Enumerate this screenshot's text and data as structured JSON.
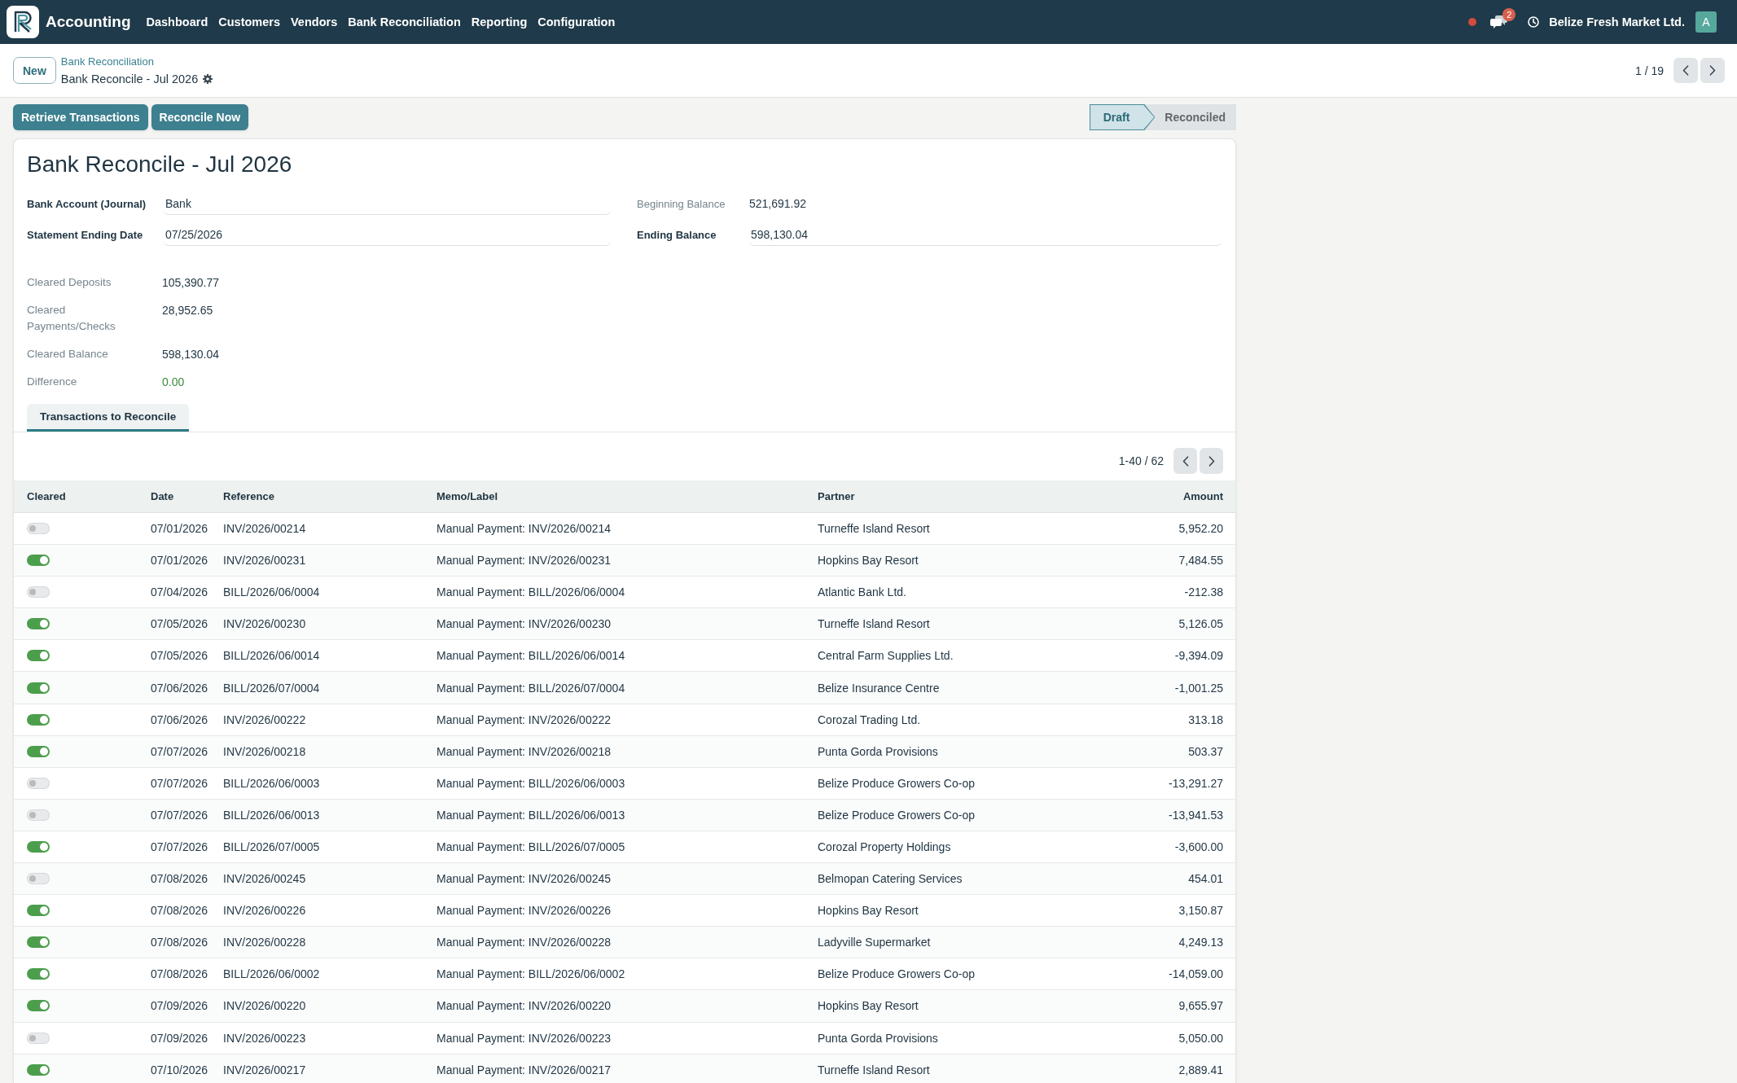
{
  "navbar": {
    "app_name": "Accounting",
    "menu": [
      "Dashboard",
      "Customers",
      "Vendors",
      "Bank Reconciliation",
      "Reporting",
      "Configuration"
    ],
    "messages_badge": "2",
    "company": "Belize Fresh Market Ltd.",
    "avatar": "A"
  },
  "control_panel": {
    "new_button": "New",
    "breadcrumb": "Bank Reconciliation",
    "record_title": "Bank Reconcile - Jul 2026",
    "pager": "1 / 19"
  },
  "action_buttons": [
    "Retrieve Transactions",
    "Reconcile Now"
  ],
  "status_steps": [
    {
      "label": "Draft",
      "selected": true
    },
    {
      "label": "Reconciled",
      "selected": false
    }
  ],
  "form": {
    "title": "Bank Reconcile - Jul 2026",
    "fields_left": [
      {
        "label": "Bank Account (Journal)",
        "value": "Bank",
        "readonly": false
      },
      {
        "label": "Statement Ending Date",
        "value": "07/25/2026",
        "readonly": false
      }
    ],
    "fields_right": [
      {
        "label": "Beginning Balance",
        "value": "521,691.92",
        "readonly": true
      },
      {
        "label": "Ending Balance",
        "value": "598,130.04",
        "readonly": false
      }
    ],
    "summary": [
      {
        "label": "Cleared Deposits",
        "value": "105,390.77",
        "readonly": true
      },
      {
        "label": "Cleared Payments/Checks",
        "value": "28,952.65",
        "readonly": true
      },
      {
        "label": "Cleared Balance",
        "value": "598,130.04",
        "readonly": true
      }
    ],
    "difference": {
      "label": "Difference",
      "value": "0.00",
      "balanced": true
    }
  },
  "tabs": [
    {
      "label": "Transactions to Reconcile",
      "selected": true
    }
  ],
  "table": {
    "pager": "1-40 / 62",
    "columns": [
      {
        "label": "Cleared",
        "kind": "toggle"
      },
      {
        "label": "Date",
        "kind": "text"
      },
      {
        "label": "Reference",
        "kind": "text"
      },
      {
        "label": "Memo/Label",
        "kind": "text"
      },
      {
        "label": "Partner",
        "kind": "text"
      },
      {
        "label": "Amount",
        "kind": "number"
      }
    ],
    "rows": [
      {
        "cells": [
          false,
          "07/01/2026",
          "INV/2026/00214",
          "Manual Payment: INV/2026/00214",
          "Turneffe Island Resort",
          "5,952.20"
        ]
      },
      {
        "cells": [
          true,
          "07/01/2026",
          "INV/2026/00231",
          "Manual Payment: INV/2026/00231",
          "Hopkins Bay Resort",
          "7,484.55"
        ]
      },
      {
        "cells": [
          false,
          "07/04/2026",
          "BILL/2026/06/0004",
          "Manual Payment: BILL/2026/06/0004",
          "Atlantic Bank Ltd.",
          "-212.38"
        ]
      },
      {
        "cells": [
          true,
          "07/05/2026",
          "INV/2026/00230",
          "Manual Payment: INV/2026/00230",
          "Turneffe Island Resort",
          "5,126.05"
        ]
      },
      {
        "cells": [
          true,
          "07/05/2026",
          "BILL/2026/06/0014",
          "Manual Payment: BILL/2026/06/0014",
          "Central Farm Supplies Ltd.",
          "-9,394.09"
        ]
      },
      {
        "cells": [
          true,
          "07/06/2026",
          "BILL/2026/07/0004",
          "Manual Payment: BILL/2026/07/0004",
          "Belize Insurance Centre",
          "-1,001.25"
        ]
      },
      {
        "cells": [
          true,
          "07/06/2026",
          "INV/2026/00222",
          "Manual Payment: INV/2026/00222",
          "Corozal Trading Ltd.",
          "313.18"
        ]
      },
      {
        "cells": [
          true,
          "07/07/2026",
          "INV/2026/00218",
          "Manual Payment: INV/2026/00218",
          "Punta Gorda Provisions",
          "503.37"
        ]
      },
      {
        "cells": [
          false,
          "07/07/2026",
          "BILL/2026/06/0003",
          "Manual Payment: BILL/2026/06/0003",
          "Belize Produce Growers Co-op",
          "-13,291.27"
        ]
      },
      {
        "cells": [
          false,
          "07/07/2026",
          "BILL/2026/06/0013",
          "Manual Payment: BILL/2026/06/0013",
          "Belize Produce Growers Co-op",
          "-13,941.53"
        ]
      },
      {
        "cells": [
          true,
          "07/07/2026",
          "BILL/2026/07/0005",
          "Manual Payment: BILL/2026/07/0005",
          "Corozal Property Holdings",
          "-3,600.00"
        ]
      },
      {
        "cells": [
          false,
          "07/08/2026",
          "INV/2026/00245",
          "Manual Payment: INV/2026/00245",
          "Belmopan Catering Services",
          "454.01"
        ]
      },
      {
        "cells": [
          true,
          "07/08/2026",
          "INV/2026/00226",
          "Manual Payment: INV/2026/00226",
          "Hopkins Bay Resort",
          "3,150.87"
        ]
      },
      {
        "cells": [
          true,
          "07/08/2026",
          "INV/2026/00228",
          "Manual Payment: INV/2026/00228",
          "Ladyville Supermarket",
          "4,249.13"
        ]
      },
      {
        "cells": [
          true,
          "07/08/2026",
          "BILL/2026/06/0002",
          "Manual Payment: BILL/2026/06/0002",
          "Belize Produce Growers Co-op",
          "-14,059.00"
        ]
      },
      {
        "cells": [
          true,
          "07/09/2026",
          "INV/2026/00220",
          "Manual Payment: INV/2026/00220",
          "Hopkins Bay Resort",
          "9,655.97"
        ]
      },
      {
        "cells": [
          false,
          "07/09/2026",
          "INV/2026/00223",
          "Manual Payment: INV/2026/00223",
          "Punta Gorda Provisions",
          "5,050.00"
        ]
      },
      {
        "cells": [
          true,
          "07/10/2026",
          "INV/2026/00217",
          "Manual Payment: INV/2026/00217",
          "Turneffe Island Resort",
          "2,889.41"
        ]
      }
    ]
  }
}
